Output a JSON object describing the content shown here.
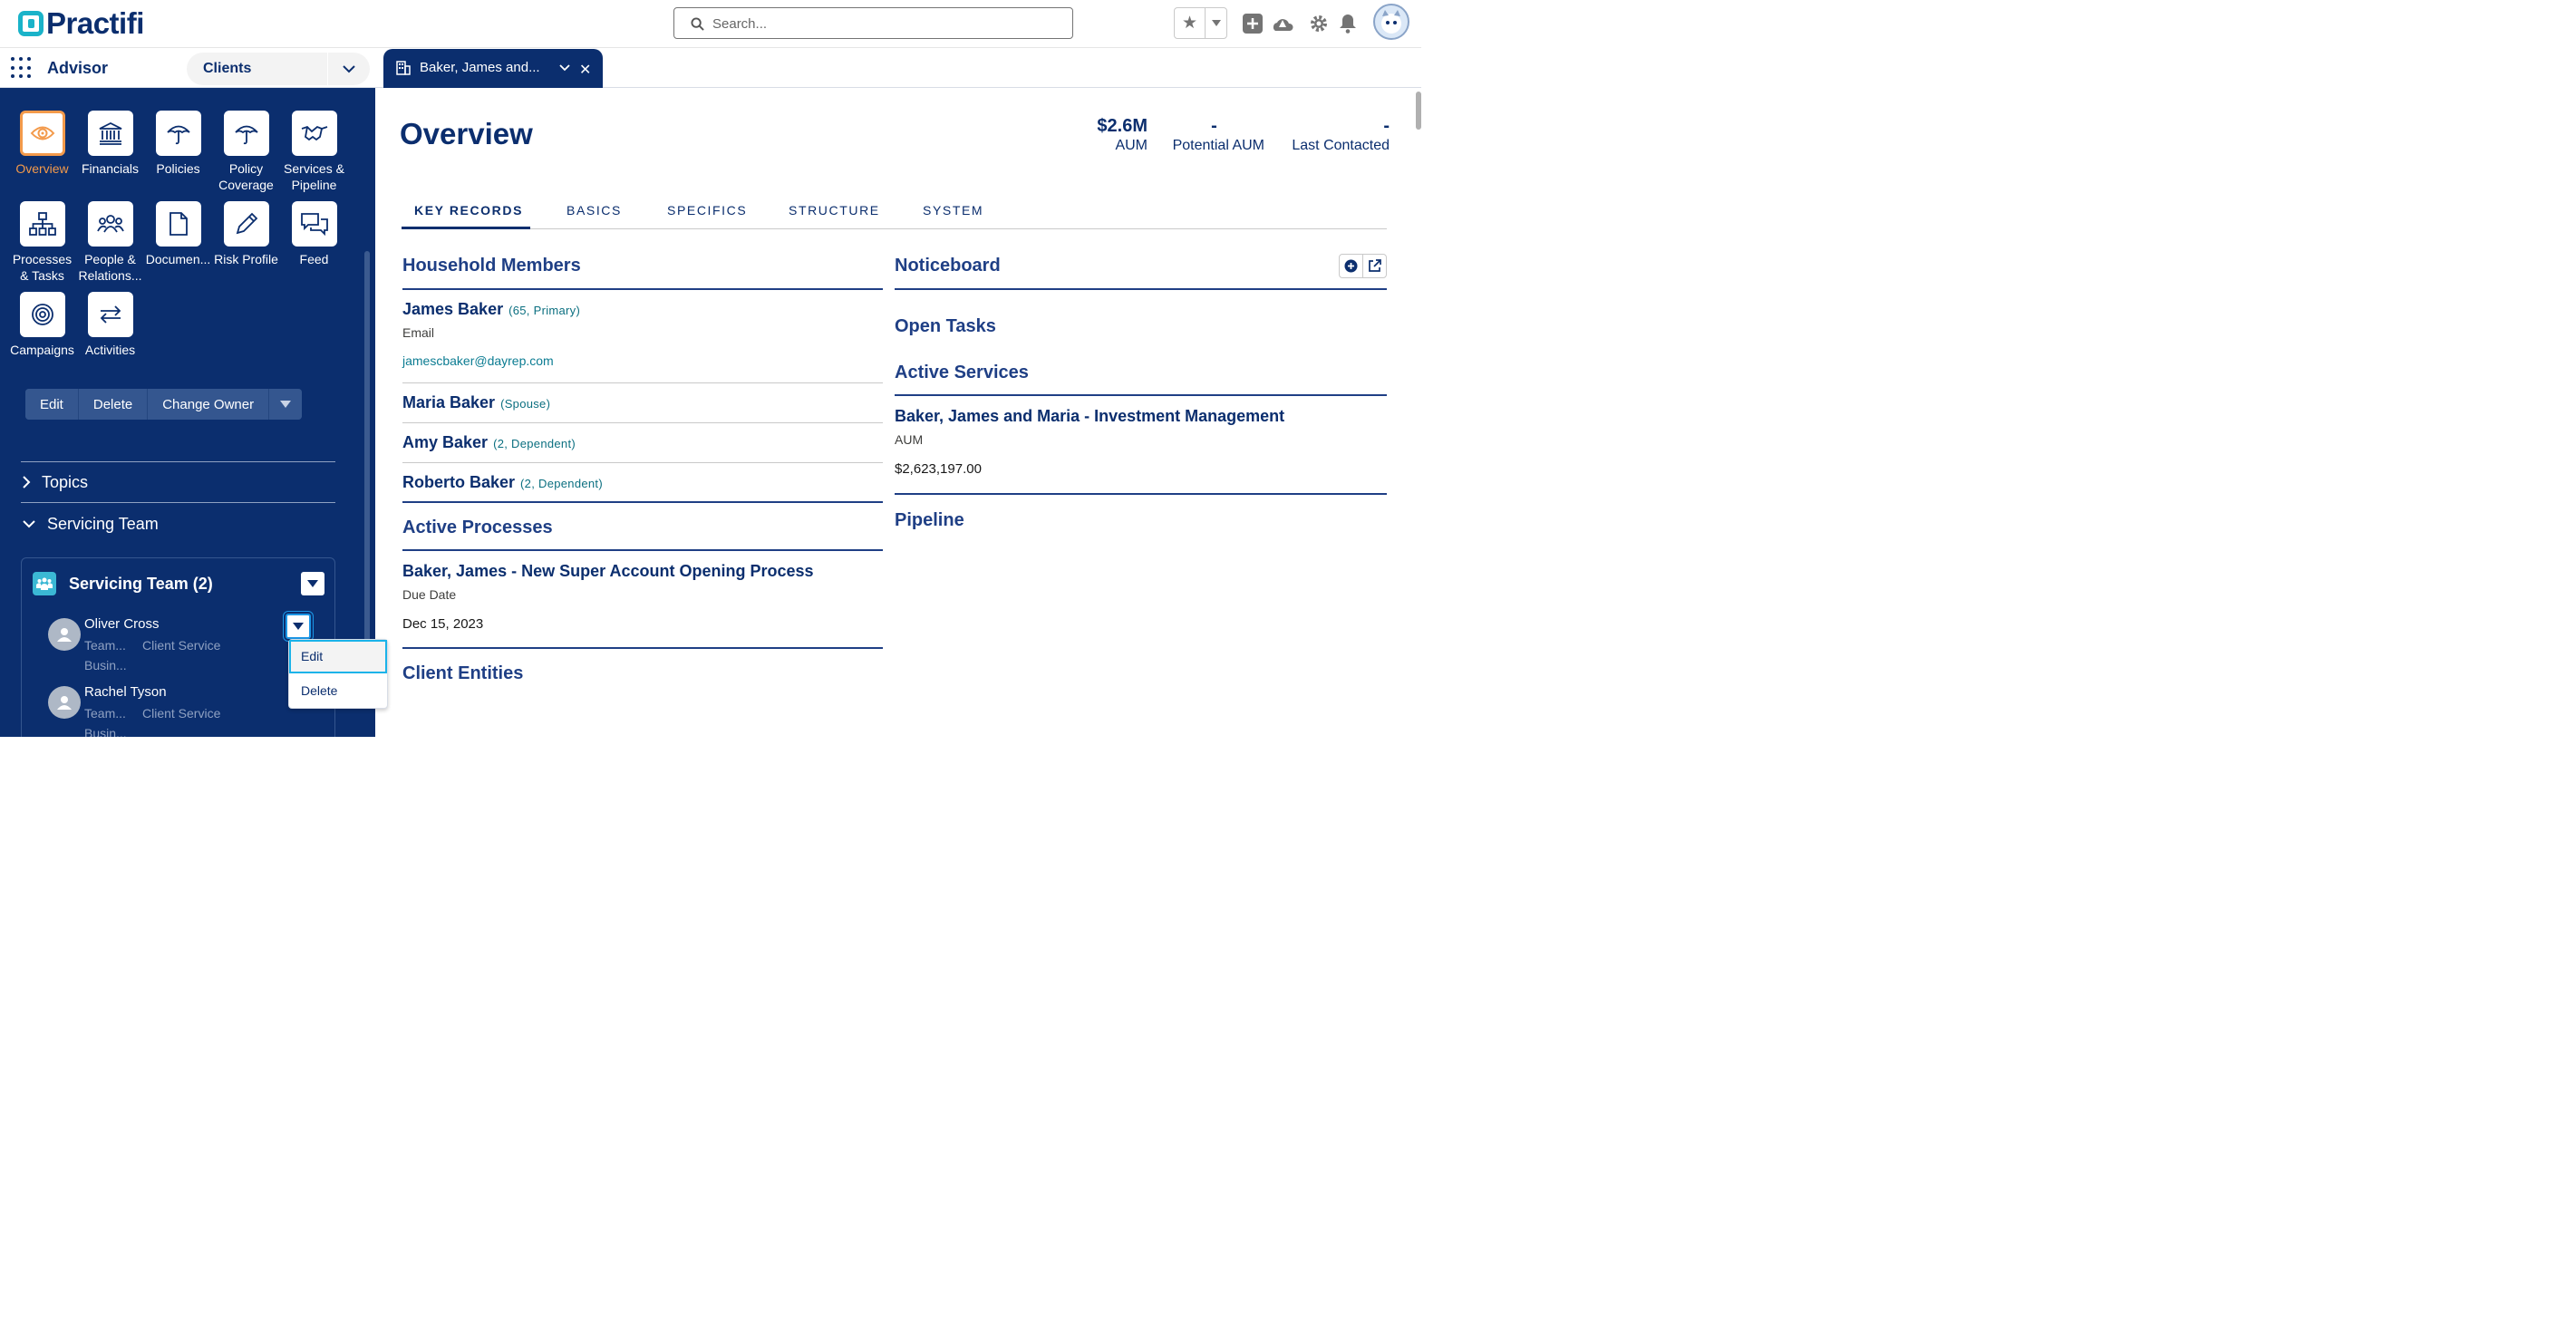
{
  "header": {
    "logo_text": "Practifi",
    "search_placeholder": "Search..."
  },
  "appbar": {
    "app_name": "Advisor",
    "object_selector": "Clients",
    "workspace_tab": "Baker, James and..."
  },
  "sidebar": {
    "tiles": [
      {
        "label": "Overview",
        "icon": "eye-icon",
        "active": true
      },
      {
        "label": "Financials",
        "icon": "bank-icon"
      },
      {
        "label": "Policies",
        "icon": "umbrella-icon"
      },
      {
        "label": "Policy Coverage",
        "icon": "umbrella-icon"
      },
      {
        "label": "Services & Pipeline",
        "icon": "handshake-icon"
      },
      {
        "label": "Processes & Tasks",
        "icon": "hierarchy-icon"
      },
      {
        "label": "People & Relations...",
        "icon": "people-icon"
      },
      {
        "label": "Documen...",
        "icon": "document-icon"
      },
      {
        "label": "Risk Profile",
        "icon": "pencil-icon"
      },
      {
        "label": "Feed",
        "icon": "chat-icon"
      },
      {
        "label": "Campaigns",
        "icon": "target-icon"
      },
      {
        "label": "Activities",
        "icon": "arrows-icon"
      }
    ],
    "actions": {
      "edit": "Edit",
      "delete": "Delete",
      "change_owner": "Change Owner"
    },
    "topics": "Topics",
    "servicing_team": "Servicing Team",
    "card": {
      "title": "Servicing Team (2)",
      "members": [
        {
          "name": "Oliver Cross",
          "field1": "Team...",
          "value1": "Client Service",
          "field2": "Busin..."
        },
        {
          "name": "Rachel Tyson",
          "field1": "Team...",
          "value1": "Client Service",
          "field2": "Busin..."
        }
      ]
    },
    "menu": {
      "edit": "Edit",
      "delete": "Delete"
    }
  },
  "main": {
    "title": "Overview",
    "metrics": [
      {
        "value": "$2.6M",
        "label": "AUM"
      },
      {
        "value": "-",
        "label": "Potential AUM"
      },
      {
        "value": "-",
        "label": "Last Contacted"
      }
    ],
    "tabs": [
      "KEY RECORDS",
      "BASICS",
      "SPECIFICS",
      "STRUCTURE",
      "SYSTEM"
    ],
    "household": {
      "title": "Household Members",
      "members": [
        {
          "name": "James Baker",
          "sub": "(65, Primary)",
          "field_label": "Email",
          "field_value": "jamescbaker@dayrep.com"
        },
        {
          "name": "Maria Baker",
          "sub": "(Spouse)"
        },
        {
          "name": "Amy Baker",
          "sub": "(2, Dependent)"
        },
        {
          "name": "Roberto Baker",
          "sub": "(2, Dependent)"
        }
      ]
    },
    "active_processes": {
      "title": "Active Processes",
      "item": "Baker, James - New Super Account Opening Process",
      "field_label": "Due Date",
      "field_value": "Dec 15, 2023"
    },
    "client_entities": "Client Entities",
    "noticeboard": "Noticeboard",
    "open_tasks": "Open Tasks",
    "active_services": {
      "title": "Active Services",
      "item": "Baker, James and Maria - Investment Management",
      "field_label": "AUM",
      "field_value": "$2,623,197.00"
    },
    "pipeline": "Pipeline"
  }
}
